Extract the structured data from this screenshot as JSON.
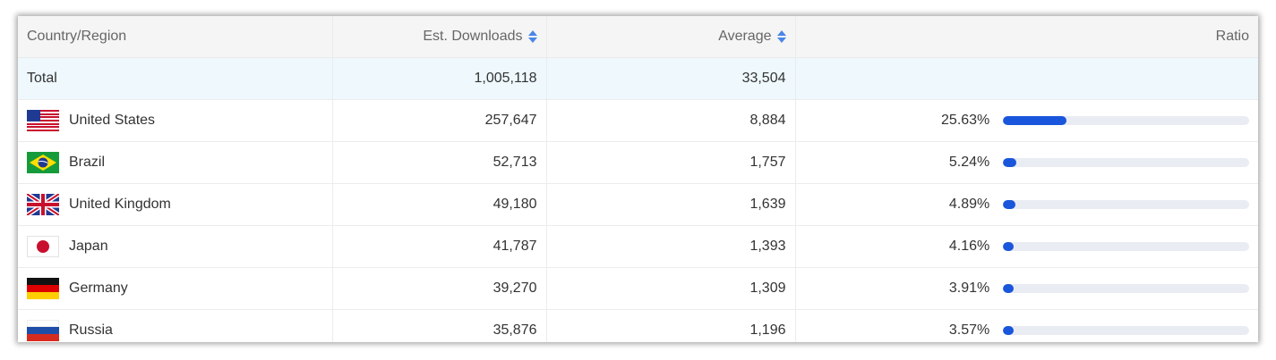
{
  "table": {
    "headers": {
      "country": "Country/Region",
      "downloads": "Est. Downloads",
      "average": "Average",
      "ratio": "Ratio"
    },
    "total": {
      "label": "Total",
      "downloads": "1,005,118",
      "average": "33,504"
    },
    "rows": [
      {
        "country": "United States",
        "flag": "us-flag-icon",
        "downloads": "257,647",
        "average": "8,884",
        "ratio": "25.63%",
        "ratio_value": 25.63
      },
      {
        "country": "Brazil",
        "flag": "br-flag-icon",
        "downloads": "52,713",
        "average": "1,757",
        "ratio": "5.24%",
        "ratio_value": 5.24
      },
      {
        "country": "United Kingdom",
        "flag": "gb-flag-icon",
        "downloads": "49,180",
        "average": "1,639",
        "ratio": "4.89%",
        "ratio_value": 4.89
      },
      {
        "country": "Japan",
        "flag": "jp-flag-icon",
        "downloads": "41,787",
        "average": "1,393",
        "ratio": "4.16%",
        "ratio_value": 4.16
      },
      {
        "country": "Germany",
        "flag": "de-flag-icon",
        "downloads": "39,270",
        "average": "1,309",
        "ratio": "3.91%",
        "ratio_value": 3.91
      },
      {
        "country": "Russia",
        "flag": "ru-flag-icon",
        "downloads": "35,876",
        "average": "1,196",
        "ratio": "3.57%",
        "ratio_value": 3.57
      }
    ]
  },
  "colors": {
    "accent": "#1a56db",
    "sort_icon": "#4a86e8",
    "total_row_bg": "#eef8fd",
    "header_bg": "#f5f5f5"
  }
}
